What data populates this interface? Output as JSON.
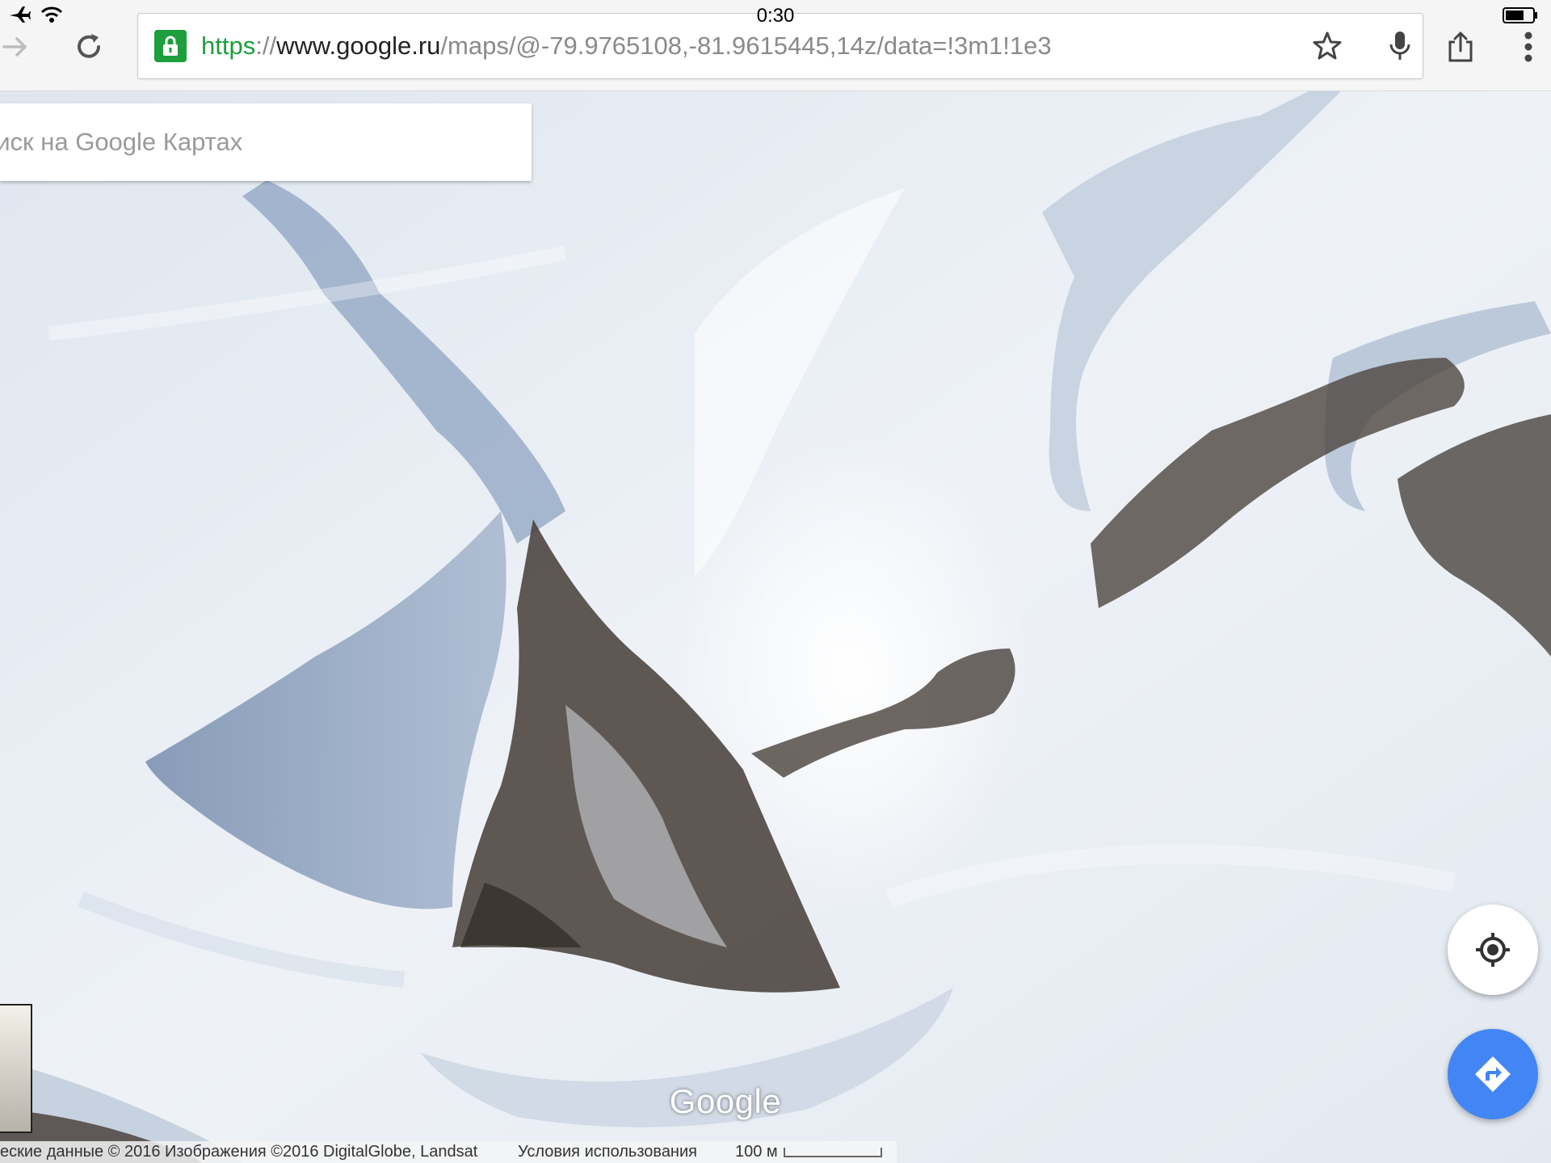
{
  "status_bar": {
    "time": "0:30",
    "icons": [
      "airplane-icon",
      "wifi-icon",
      "battery-icon"
    ]
  },
  "browser": {
    "url_protocol": "https",
    "url_separator": "://",
    "url_host": "www.google.ru",
    "url_path": "/maps/@-79.9765108,-81.9615445,14z/data=!3m1!1e3",
    "icons": [
      "forward-icon",
      "reload-icon",
      "lock-icon",
      "star-icon",
      "microphone-icon",
      "share-icon",
      "more-icon"
    ]
  },
  "map": {
    "search_placeholder": "оиск на Google Картах",
    "logo": "Google",
    "attribution": "еские данные © 2016 Изображения ©2016 DigitalGlobe, Landsat",
    "terms": "Условия использования",
    "scale_label": "100 м",
    "colors": {
      "snow": "#eef2f8",
      "shadow": "#8a9fbd",
      "rock": "#3a3430",
      "directions_button": "#4285f4",
      "secure_green": "#1e9e3c"
    }
  }
}
